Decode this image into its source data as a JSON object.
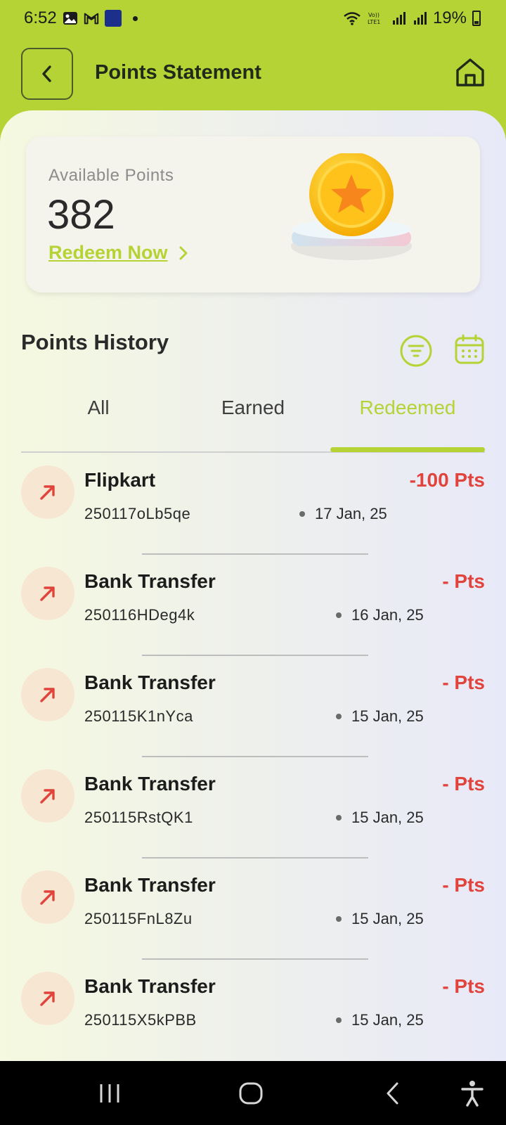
{
  "status_bar": {
    "time": "6:52",
    "icons": [
      "image-icon",
      "gmail-icon",
      "app-icon",
      "notification-dot-icon"
    ],
    "right_icons": [
      "wifi-icon",
      "volte-icon",
      "signal-icon",
      "signal-icon"
    ],
    "battery": "19%"
  },
  "header": {
    "title": "Points Statement",
    "back_icon": "chevron-left-icon",
    "home_icon": "home-icon"
  },
  "points_card": {
    "label": "Available Points",
    "value": "382",
    "redeem_label": "Redeem Now"
  },
  "history": {
    "title": "Points History",
    "tabs": [
      {
        "label": "All",
        "active": false
      },
      {
        "label": "Earned",
        "active": false
      },
      {
        "label": "Redeemed",
        "active": true
      }
    ],
    "items": [
      {
        "title": "Flipkart",
        "id": "250117oLb5qe",
        "date": "17 Jan, 25",
        "amount": "-100 Pts"
      },
      {
        "title": "Bank Transfer",
        "id": "250116HDeg4k",
        "date": "16 Jan, 25",
        "amount": "- Pts"
      },
      {
        "title": "Bank Transfer",
        "id": "250115K1nYca",
        "date": "15 Jan, 25",
        "amount": "- Pts"
      },
      {
        "title": "Bank Transfer",
        "id": "250115RstQK1",
        "date": "15 Jan, 25",
        "amount": "- Pts"
      },
      {
        "title": "Bank Transfer",
        "id": "250115FnL8Zu",
        "date": "15 Jan, 25",
        "amount": "- Pts"
      },
      {
        "title": "Bank Transfer",
        "id": "250115X5kPBB",
        "date": "15 Jan, 25",
        "amount": "- Pts"
      }
    ]
  },
  "colors": {
    "accent": "#b5d334",
    "debit": "#e0443c",
    "icon_bg": "#f6e6d2"
  }
}
